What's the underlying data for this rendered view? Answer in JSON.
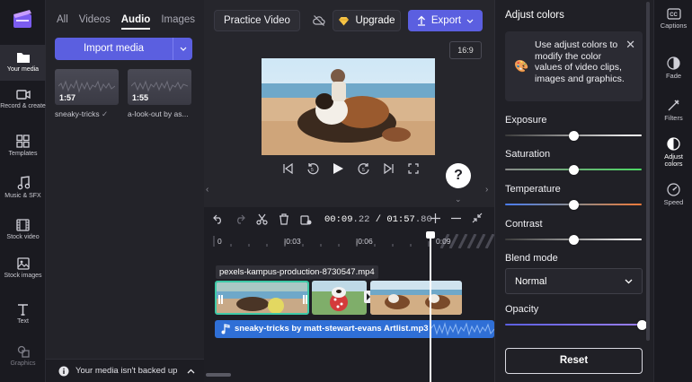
{
  "nav": {
    "items": [
      {
        "label": "Your media",
        "icon": "folder-icon",
        "active": true
      },
      {
        "label": "Record & create",
        "icon": "camera-icon"
      },
      {
        "label": "Templates",
        "icon": "templates-icon"
      },
      {
        "label": "Music & SFX",
        "icon": "music-icon"
      },
      {
        "label": "Stock video",
        "icon": "film-icon"
      },
      {
        "label": "Stock images",
        "icon": "image-icon"
      },
      {
        "label": "Text",
        "icon": "text-icon"
      },
      {
        "label": "Graphics",
        "icon": "graphics-icon"
      }
    ]
  },
  "media": {
    "tabs": [
      "All",
      "Videos",
      "Audio",
      "Images"
    ],
    "active_tab": "Audio",
    "import_label": "Import media",
    "items": [
      {
        "duration": "1:57",
        "name": "sneaky-tricks"
      },
      {
        "duration": "1:55",
        "name": "a-look-out by as..."
      }
    ],
    "backup_text": "Your media isn't backed up"
  },
  "header": {
    "project_title": "Practice Video",
    "upgrade_label": "Upgrade",
    "export_label": "Export",
    "aspect_ratio": "16:9"
  },
  "timeline": {
    "current_time": "00:09",
    "current_frac": ".22",
    "separator": " / ",
    "total_time": "01:57",
    "total_frac": ".80",
    "ticks": [
      "0",
      "|0:03",
      "|0:06",
      "0:09"
    ],
    "clip_label": "pexels-kampus-production-8730547.mp4",
    "audio_label": "sneaky-tricks by matt-stewart-evans Artlist.mp3"
  },
  "panel": {
    "title": "Adjust colors",
    "tip": "Use adjust colors to modify the color values of video clips, images and graphics.",
    "sliders": [
      {
        "label": "Exposure",
        "value": 0.5
      },
      {
        "label": "Saturation",
        "value": 0.5
      },
      {
        "label": "Temperature",
        "value": 0.5
      },
      {
        "label": "Contrast",
        "value": 0.5
      }
    ],
    "blend_label": "Blend mode",
    "blend_value": "Normal",
    "opacity_label": "Opacity",
    "opacity_value": 1.0,
    "reset_label": "Reset"
  },
  "props": {
    "items": [
      {
        "label": "Captions",
        "icon": "captions-icon"
      },
      {
        "label": "Fade",
        "icon": "fade-icon"
      },
      {
        "label": "Filters",
        "icon": "filters-icon"
      },
      {
        "label": "Adjust colors",
        "icon": "adjust-colors-icon",
        "active": true
      },
      {
        "label": "Speed",
        "icon": "speed-icon"
      }
    ]
  },
  "colors": {
    "accent": "#5b5fe0",
    "audio": "#2f6fd6",
    "clip_selected": "#3ec9a7"
  }
}
